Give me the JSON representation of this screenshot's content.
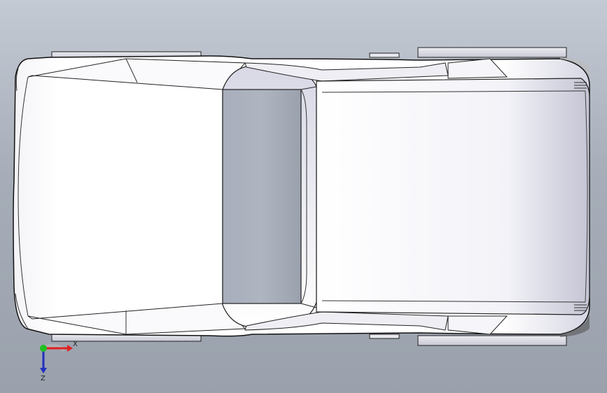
{
  "view": {
    "model_type": "car body (top view)",
    "background_top": "#c4cad4",
    "background_bottom": "#9aa1ac"
  },
  "triad": {
    "x_label": "X",
    "z_label": "Z",
    "x_color": "#e02020",
    "z_color": "#2030c0",
    "origin_color": "#20c020"
  }
}
